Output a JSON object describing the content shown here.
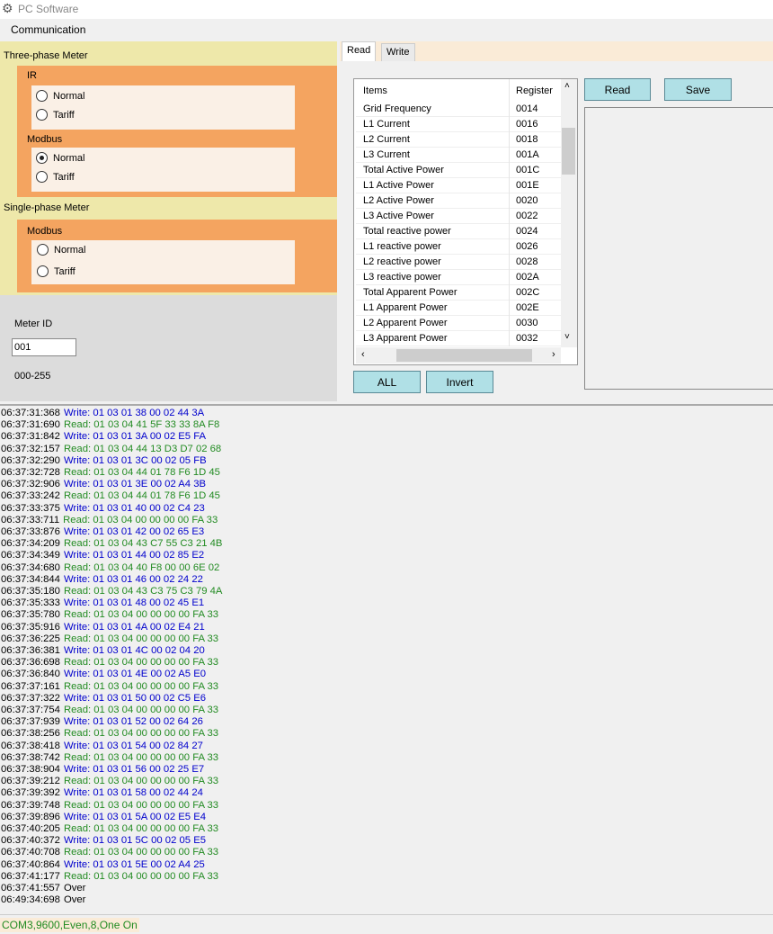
{
  "window": {
    "title": "PC Software"
  },
  "menu": {
    "communication": "Communication"
  },
  "three_phase": {
    "label": "Three-phase Meter",
    "ir": {
      "label": "IR",
      "options": [
        "Normal",
        "Tariff"
      ],
      "selected": null
    },
    "modbus": {
      "label": "Modbus",
      "options": [
        "Normal",
        "Tariff"
      ],
      "selected": "Normal"
    }
  },
  "single_phase": {
    "label": "Single-phase Meter",
    "modbus": {
      "label": "Modbus",
      "options": [
        "Normal",
        "Tariff"
      ],
      "selected": null
    }
  },
  "meter_id": {
    "label": "Meter ID",
    "value": "001",
    "range": "000-255"
  },
  "tabs": [
    {
      "label": "Read",
      "active": true
    },
    {
      "label": "Write",
      "active": false
    }
  ],
  "list": {
    "headers": [
      "Items",
      "Register"
    ],
    "rows": [
      [
        "Grid Frequency",
        "0014"
      ],
      [
        "L1 Current",
        "0016"
      ],
      [
        "L2 Current",
        "0018"
      ],
      [
        "L3 Current",
        "001A"
      ],
      [
        "Total Active Power",
        "001C"
      ],
      [
        "L1 Active Power",
        "001E"
      ],
      [
        "L2 Active Power",
        "0020"
      ],
      [
        "L3 Active Power",
        "0022"
      ],
      [
        "Total reactive power",
        "0024"
      ],
      [
        "L1 reactive power",
        "0026"
      ],
      [
        "L2 reactive power",
        "0028"
      ],
      [
        "L3 reactive power",
        "002A"
      ],
      [
        "Total Apparent Power",
        "002C"
      ],
      [
        "L1 Apparent Power",
        "002E"
      ],
      [
        "L2 Apparent Power",
        "0030"
      ],
      [
        "L3 Apparent Power",
        "0032"
      ]
    ]
  },
  "buttons": {
    "read": "Read",
    "save": "Save",
    "all": "ALL",
    "invert": "Invert"
  },
  "colors": {
    "write": "#0000cd",
    "read": "#228b22",
    "other": "#000000"
  },
  "log": [
    [
      "06:37:31:368",
      "Write:",
      "01 03 01 38 00 02 44 3A"
    ],
    [
      "06:37:31:690",
      "Read:",
      "01 03 04 41 5F 33 33 8A F8"
    ],
    [
      "06:37:31:842",
      "Write:",
      "01 03 01 3A 00 02 E5 FA"
    ],
    [
      "06:37:32:157",
      "Read:",
      "01 03 04 44 13 D3 D7 02 68"
    ],
    [
      "06:37:32:290",
      "Write:",
      "01 03 01 3C 00 02 05 FB"
    ],
    [
      "06:37:32:728",
      "Read:",
      "01 03 04 44 01 78 F6 1D 45"
    ],
    [
      "06:37:32:906",
      "Write:",
      "01 03 01 3E 00 02 A4 3B"
    ],
    [
      "06:37:33:242",
      "Read:",
      "01 03 04 44 01 78 F6 1D 45"
    ],
    [
      "06:37:33:375",
      "Write:",
      "01 03 01 40 00 02 C4 23"
    ],
    [
      "06:37:33:711",
      "Read:",
      "01 03 04 00 00 00 00 FA 33"
    ],
    [
      "06:37:33:876",
      "Write:",
      "01 03 01 42 00 02 65 E3"
    ],
    [
      "06:37:34:209",
      "Read:",
      "01 03 04 43 C7 55 C3 21 4B"
    ],
    [
      "06:37:34:349",
      "Write:",
      "01 03 01 44 00 02 85 E2"
    ],
    [
      "06:37:34:680",
      "Read:",
      "01 03 04 40 F8 00 00 6E 02"
    ],
    [
      "06:37:34:844",
      "Write:",
      "01 03 01 46 00 02 24 22"
    ],
    [
      "06:37:35:180",
      "Read:",
      "01 03 04 43 C3 75 C3 79 4A"
    ],
    [
      "06:37:35:333",
      "Write:",
      "01 03 01 48 00 02 45 E1"
    ],
    [
      "06:37:35:780",
      "Read:",
      "01 03 04 00 00 00 00 FA 33"
    ],
    [
      "06:37:35:916",
      "Write:",
      "01 03 01 4A 00 02 E4 21"
    ],
    [
      "06:37:36:225",
      "Read:",
      "01 03 04 00 00 00 00 FA 33"
    ],
    [
      "06:37:36:381",
      "Write:",
      "01 03 01 4C 00 02 04 20"
    ],
    [
      "06:37:36:698",
      "Read:",
      "01 03 04 00 00 00 00 FA 33"
    ],
    [
      "06:37:36:840",
      "Write:",
      "01 03 01 4E 00 02 A5 E0"
    ],
    [
      "06:37:37:161",
      "Read:",
      "01 03 04 00 00 00 00 FA 33"
    ],
    [
      "06:37:37:322",
      "Write:",
      "01 03 01 50 00 02 C5 E6"
    ],
    [
      "06:37:37:754",
      "Read:",
      "01 03 04 00 00 00 00 FA 33"
    ],
    [
      "06:37:37:939",
      "Write:",
      "01 03 01 52 00 02 64 26"
    ],
    [
      "06:37:38:256",
      "Read:",
      "01 03 04 00 00 00 00 FA 33"
    ],
    [
      "06:37:38:418",
      "Write:",
      "01 03 01 54 00 02 84 27"
    ],
    [
      "06:37:38:742",
      "Read:",
      "01 03 04 00 00 00 00 FA 33"
    ],
    [
      "06:37:38:904",
      "Write:",
      "01 03 01 56 00 02 25 E7"
    ],
    [
      "06:37:39:212",
      "Read:",
      "01 03 04 00 00 00 00 FA 33"
    ],
    [
      "06:37:39:392",
      "Write:",
      "01 03 01 58 00 02 44 24"
    ],
    [
      "06:37:39:748",
      "Read:",
      "01 03 04 00 00 00 00 FA 33"
    ],
    [
      "06:37:39:896",
      "Write:",
      "01 03 01 5A 00 02 E5 E4"
    ],
    [
      "06:37:40:205",
      "Read:",
      "01 03 04 00 00 00 00 FA 33"
    ],
    [
      "06:37:40:372",
      "Write:",
      "01 03 01 5C 00 02 05 E5"
    ],
    [
      "06:37:40:708",
      "Read:",
      "01 03 04 00 00 00 00 FA 33"
    ],
    [
      "06:37:40:864",
      "Write:",
      "01 03 01 5E 00 02 A4 25"
    ],
    [
      "06:37:41:177",
      "Read:",
      "01 03 04 00 00 00 00 FA 33"
    ],
    [
      "06:37:41:557",
      "Over",
      ""
    ],
    [
      "06:49:34:698",
      "Over",
      ""
    ]
  ],
  "status": {
    "text": "COM3,9600,Even,8,One  On"
  }
}
